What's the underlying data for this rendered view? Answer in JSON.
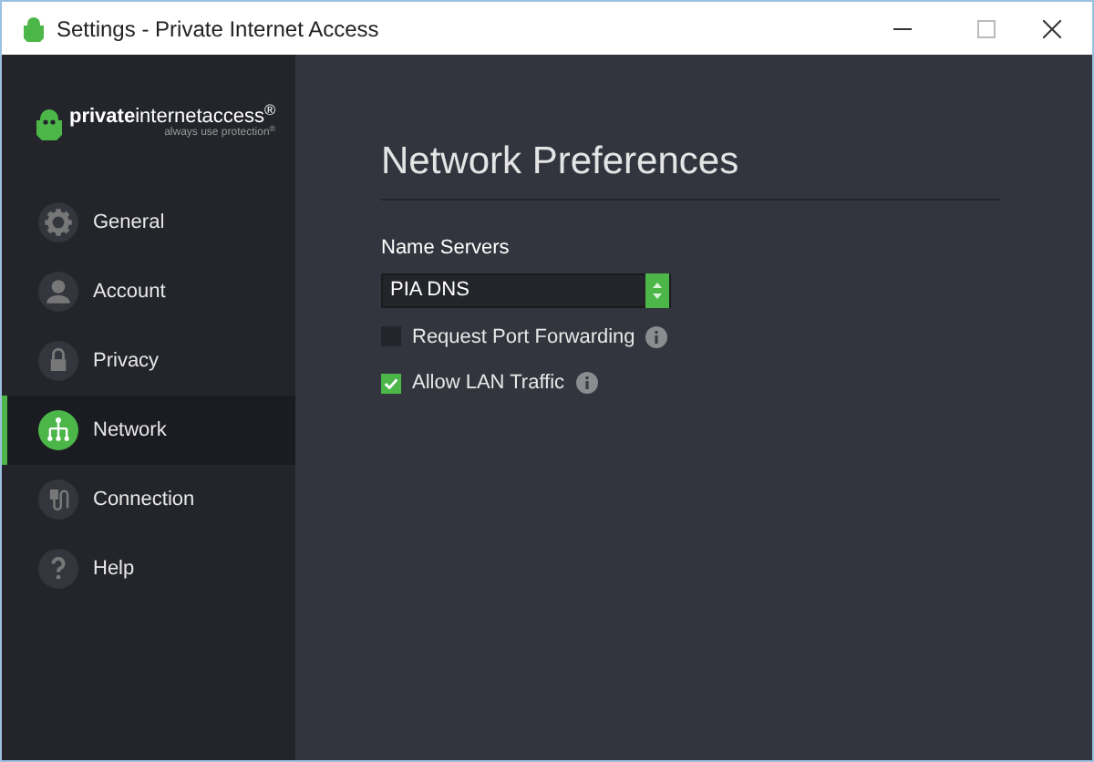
{
  "window": {
    "title": "Settings - Private Internet Access"
  },
  "logo": {
    "brand": "**private**internetaccess$^{®}$",
    "tagline": "always use protection$^{®}$"
  },
  "sidebar": {
    "items": [
      {
        "label": "General",
        "kind": "gear",
        "selected": false
      },
      {
        "label": "Account",
        "kind": "person",
        "selected": false
      },
      {
        "label": "Privacy",
        "kind": "lock",
        "selected": false
      },
      {
        "label": "Network",
        "kind": "network",
        "selected": true
      },
      {
        "label": "Connection",
        "kind": "plug",
        "selected": false
      },
      {
        "label": "Help",
        "kind": "help",
        "selected": false
      }
    ]
  },
  "content": {
    "heading": "Network Preferences",
    "name_servers": {
      "label": "Name Servers",
      "value": "PIA DNS"
    },
    "options": [
      {
        "label": "Request Port Forwarding",
        "checked": false
      },
      {
        "label": "Allow LAN Traffic",
        "checked": true
      }
    ]
  }
}
